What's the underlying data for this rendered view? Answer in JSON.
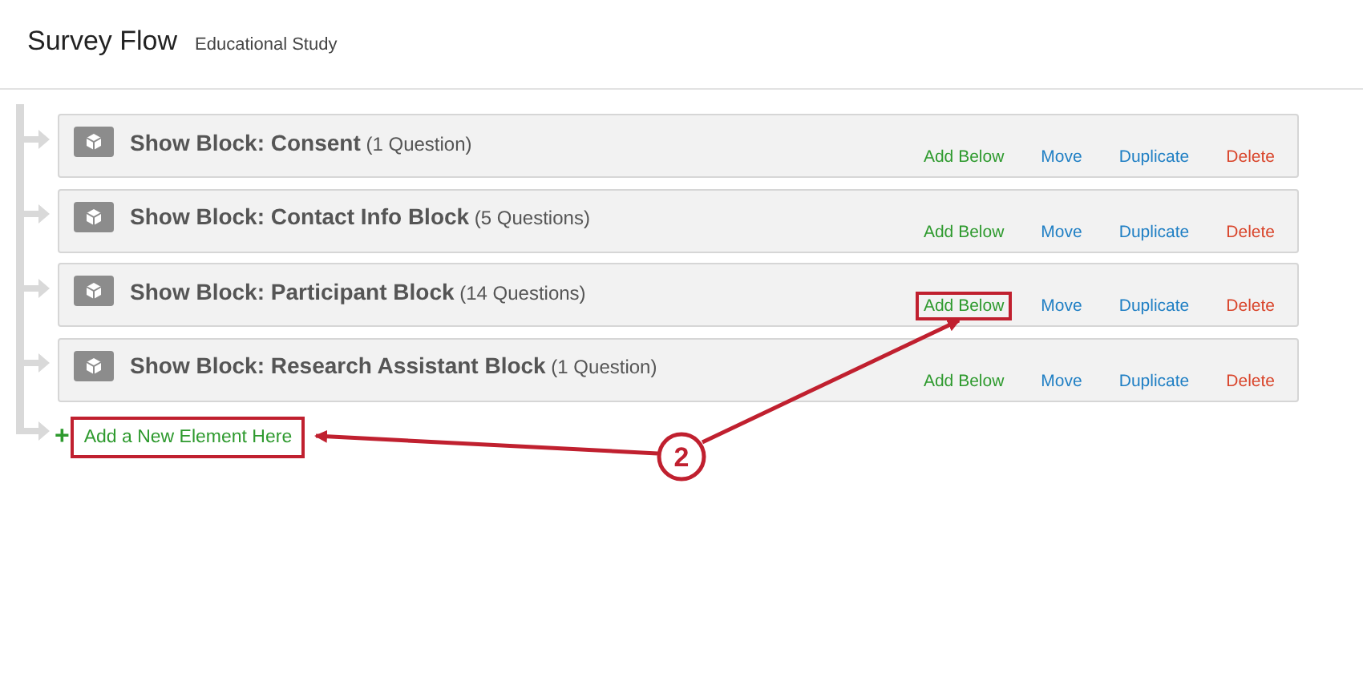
{
  "header": {
    "title": "Survey Flow",
    "subtitle": "Educational Study"
  },
  "blocks": [
    {
      "label": "Show Block: Consent",
      "count": "(1 Question)",
      "actions": [
        {
          "kind": "add",
          "label": "Add Below",
          "highlighted": false
        },
        {
          "kind": "move",
          "label": "Move",
          "highlighted": false
        },
        {
          "kind": "duplicate",
          "label": "Duplicate",
          "highlighted": false
        },
        {
          "kind": "delete",
          "label": "Delete",
          "highlighted": false
        }
      ]
    },
    {
      "label": "Show Block: Contact Info Block",
      "count": "(5 Questions)",
      "actions": [
        {
          "kind": "add",
          "label": "Add Below",
          "highlighted": false
        },
        {
          "kind": "move",
          "label": "Move",
          "highlighted": false
        },
        {
          "kind": "duplicate",
          "label": "Duplicate",
          "highlighted": false
        },
        {
          "kind": "delete",
          "label": "Delete",
          "highlighted": false
        }
      ]
    },
    {
      "label": "Show Block: Participant Block",
      "count": "(14 Questions)",
      "actions": [
        {
          "kind": "add",
          "label": "Add Below",
          "highlighted": true
        },
        {
          "kind": "move",
          "label": "Move",
          "highlighted": false
        },
        {
          "kind": "duplicate",
          "label": "Duplicate",
          "highlighted": false
        },
        {
          "kind": "delete",
          "label": "Delete",
          "highlighted": false
        }
      ]
    },
    {
      "label": "Show Block: Research Assistant Block",
      "count": "(1 Question)",
      "actions": [
        {
          "kind": "add",
          "label": "Add Below",
          "highlighted": false
        },
        {
          "kind": "move",
          "label": "Move",
          "highlighted": false
        },
        {
          "kind": "duplicate",
          "label": "Duplicate",
          "highlighted": false
        },
        {
          "kind": "delete",
          "label": "Delete",
          "highlighted": false
        }
      ]
    }
  ],
  "add_element": {
    "icon": "+",
    "label": "Add a New Element Here",
    "highlighted": true
  },
  "callout": {
    "number": "2"
  }
}
